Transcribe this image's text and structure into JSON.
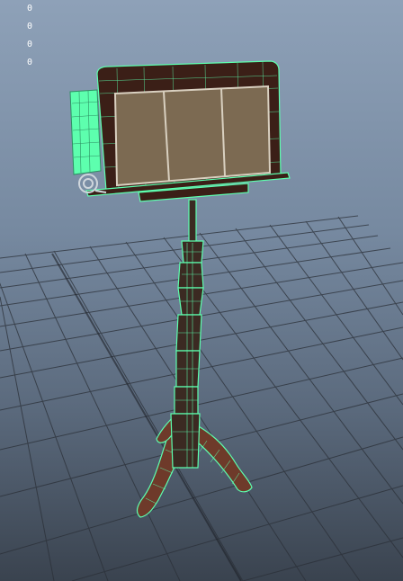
{
  "hud": {
    "stats": [
      "0",
      "0",
      "0",
      "0"
    ]
  },
  "viewport": {
    "background_top": "#8ea1b8",
    "background_bottom": "#3a434f",
    "grid_color": "#2b3038",
    "wire_color": "#5dffae",
    "wood_dark": "#3b1f17",
    "wood_panel": "#7c6a52"
  },
  "scene": {
    "object": "music-stand-mesh"
  }
}
